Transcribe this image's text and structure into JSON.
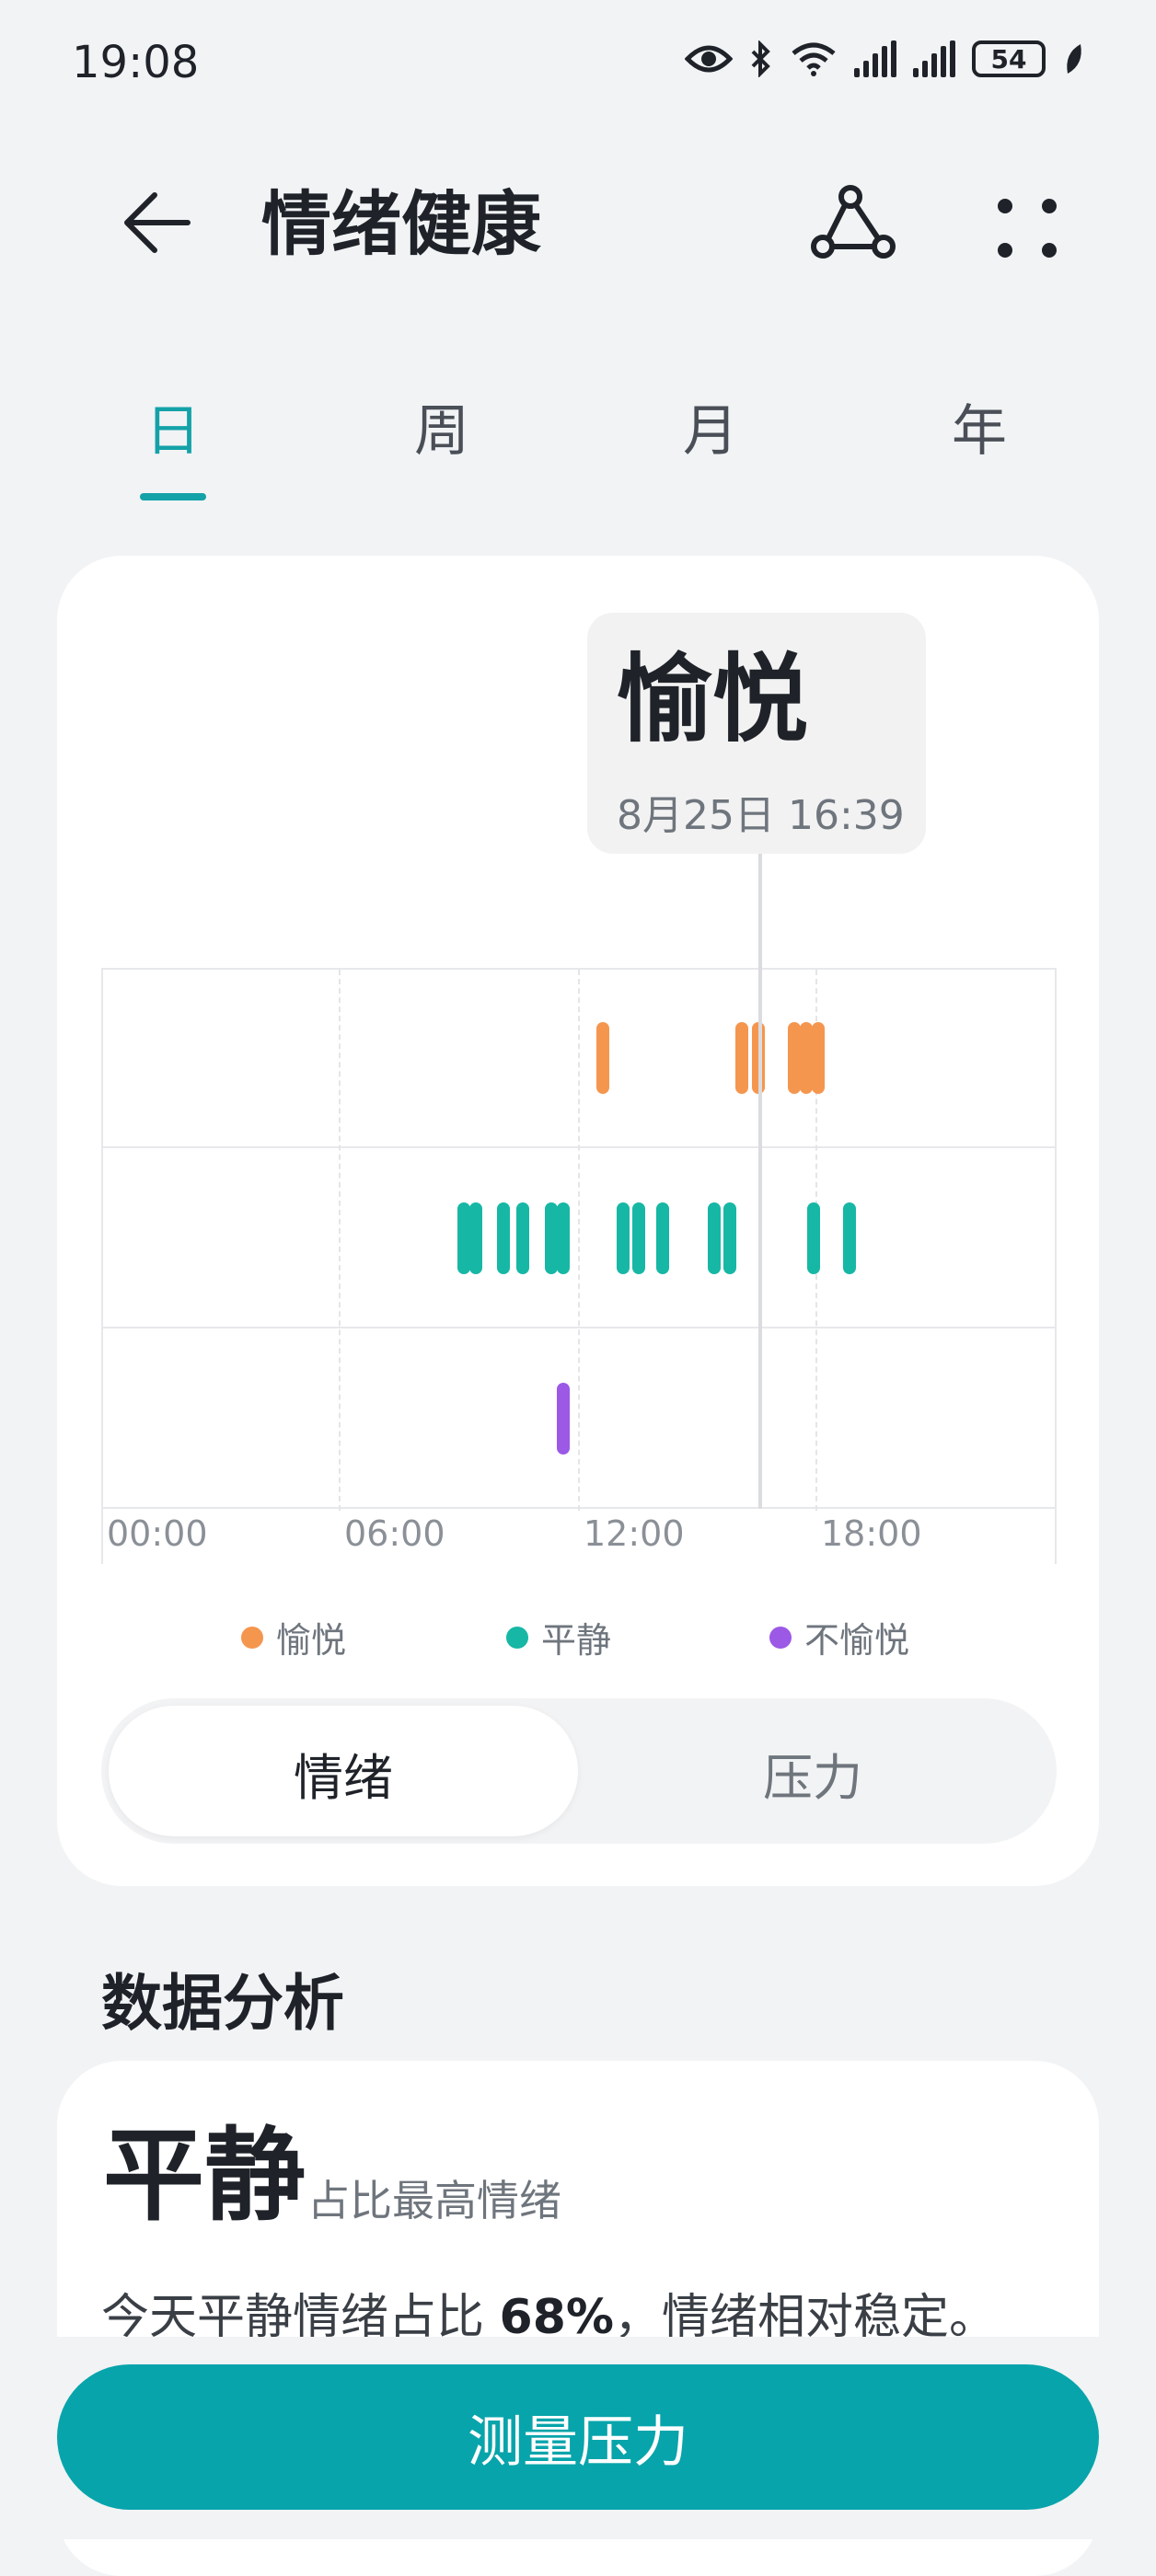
{
  "status": {
    "time": "19:08",
    "battery": "54"
  },
  "header": {
    "title": "情绪健康"
  },
  "tabs": [
    "日",
    "周",
    "月",
    "年"
  ],
  "tooltip": {
    "emotion": "愉悦",
    "datetime": "8月25日 16:39"
  },
  "chart_data": {
    "type": "timeline",
    "x_ticks": [
      "00:00",
      "06:00",
      "12:00",
      "18:00"
    ],
    "xlim_hours": [
      0,
      24
    ],
    "rows": [
      "愉悦",
      "平静",
      "不愉悦"
    ],
    "series": [
      {
        "name": "愉悦",
        "color": "#f5964f",
        "times": [
          12.6,
          16.1,
          16.5,
          17.4,
          17.7,
          18.0
        ]
      },
      {
        "name": "平静",
        "color": "#17b7a5",
        "times": [
          9.1,
          9.4,
          10.1,
          10.6,
          11.3,
          11.6,
          13.1,
          13.5,
          14.1,
          15.4,
          15.8,
          17.9,
          18.8
        ]
      },
      {
        "name": "不愉悦",
        "color": "#9b59e6",
        "times": [
          11.6
        ]
      }
    ],
    "selected_time": 16.65
  },
  "legend": [
    {
      "label": "愉悦",
      "color": "#f5964f"
    },
    {
      "label": "平静",
      "color": "#17b7a5"
    },
    {
      "label": "不愉悦",
      "color": "#9b59e6"
    }
  ],
  "segment": {
    "active": "情绪",
    "inactive": "压力"
  },
  "analysis": {
    "section_title": "数据分析",
    "top_emotion": "平静",
    "top_emotion_sub": "占比最高情绪",
    "desc_prefix": "今天平静情绪占比 ",
    "desc_percent": "68%",
    "desc_suffix": "，情绪相对稳定。"
  },
  "measure_button": "测量压力"
}
